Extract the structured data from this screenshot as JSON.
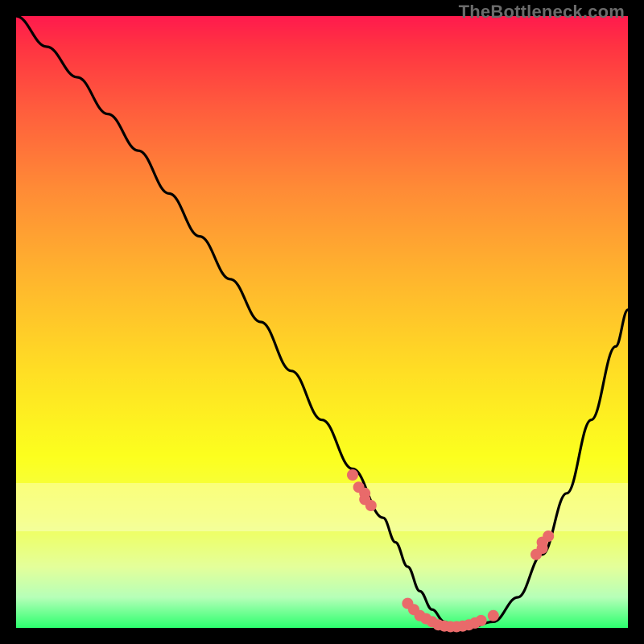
{
  "watermark": "TheBottleneck.com",
  "colors": {
    "gradient_top": "#ff1a4d",
    "gradient_bottom": "#2bff6e",
    "curve": "#000000",
    "dots": "#e96a6a",
    "page_bg": "#000000"
  },
  "chart_data": {
    "type": "line",
    "title": "",
    "xlabel": "",
    "ylabel": "",
    "xlim": [
      0,
      100
    ],
    "ylim": [
      0,
      100
    ],
    "grid": false,
    "legend": false,
    "series": [
      {
        "name": "bottleneck-curve",
        "x": [
          0,
          5,
          10,
          15,
          20,
          25,
          30,
          35,
          40,
          45,
          50,
          55,
          60,
          62,
          64,
          66,
          68,
          70,
          72,
          74,
          78,
          82,
          86,
          90,
          94,
          98,
          100
        ],
        "y": [
          100,
          95,
          90,
          84,
          78,
          71,
          64,
          57,
          50,
          42,
          34,
          26,
          18,
          14,
          10,
          6,
          3,
          1,
          0,
          0,
          1,
          5,
          12,
          22,
          34,
          46,
          52
        ]
      }
    ],
    "markers": {
      "name": "highlight-dots",
      "x": [
        55,
        56,
        57,
        57,
        58,
        64,
        65,
        66,
        67,
        68,
        69,
        70,
        71,
        72,
        73,
        74,
        75,
        76,
        78,
        85,
        86,
        86,
        87
      ],
      "y": [
        25,
        23,
        22,
        21,
        20,
        4,
        3,
        2,
        1.5,
        1,
        0.5,
        0.3,
        0.2,
        0.2,
        0.3,
        0.5,
        0.8,
        1.2,
        2,
        12,
        13,
        14,
        15
      ]
    }
  }
}
